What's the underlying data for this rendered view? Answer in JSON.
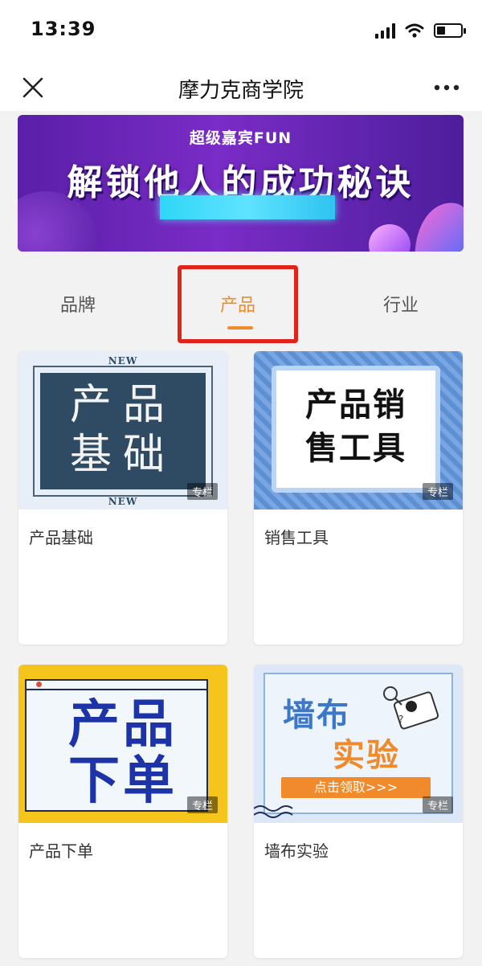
{
  "status_bar": {
    "time": "13:39",
    "battery_level": 0.35
  },
  "nav": {
    "title": "摩力克商学院"
  },
  "banner": {
    "subtitle": "超级嘉宾FUN",
    "headline": "解锁他人的成功秘诀"
  },
  "tabs": [
    {
      "label": "品牌",
      "selected": false
    },
    {
      "label": "产品",
      "selected": true
    },
    {
      "label": "行业",
      "selected": false
    }
  ],
  "cards": [
    {
      "label": "产品基础",
      "thumb_lines": [
        "产品",
        "基础"
      ],
      "new_top": "NEW",
      "new_bottom": "NEW",
      "badge": "专栏"
    },
    {
      "label": "销售工具",
      "thumb_lines": [
        "产品销",
        "售工具"
      ],
      "badge": "专栏"
    },
    {
      "label": "产品下单",
      "thumb_lines": [
        "产品",
        "下单"
      ],
      "badge": "专栏"
    },
    {
      "label": "墙布实验",
      "thumb_word1": "墙布",
      "thumb_word2": "实验",
      "thumb_cta": "点击领取>>>",
      "badge": "专栏"
    }
  ],
  "colors": {
    "accent": "#f08a2a",
    "highlight_box": "#e0241b"
  }
}
